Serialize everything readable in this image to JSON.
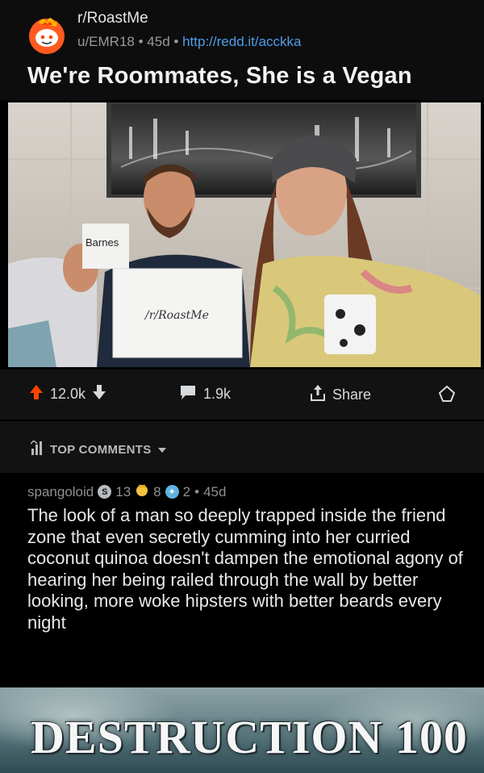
{
  "post": {
    "subreddit": "r/RoastMe",
    "author": "u/EMR18",
    "age": "45d",
    "link": "http://redd.it/acckka",
    "title": "We're Roommates, She is a Vegan",
    "mug_text": "Barnes",
    "sign_text": "/r/RoastMe"
  },
  "actions": {
    "upvotes": "12.0k",
    "comments": "1.9k",
    "share_label": "Share"
  },
  "comments_section": {
    "sort_label": "TOP COMMENTS"
  },
  "comment": {
    "username": "spangoloid",
    "silver_count": "13",
    "gold_count": "8",
    "platinum_count": "2",
    "age": "45d",
    "body": "The look of a man so deeply trapped inside the friend zone that even secretly cumming into her curried coconut quinoa doesn't dampen the emotional agony of hearing her being railed through the wall by better looking, more woke hipsters with better beards every night"
  },
  "meme": {
    "text": "DESTRUCTION 100"
  },
  "colors": {
    "upvote": "#ff4500",
    "link": "#4f9ee8",
    "background": "#000000"
  }
}
